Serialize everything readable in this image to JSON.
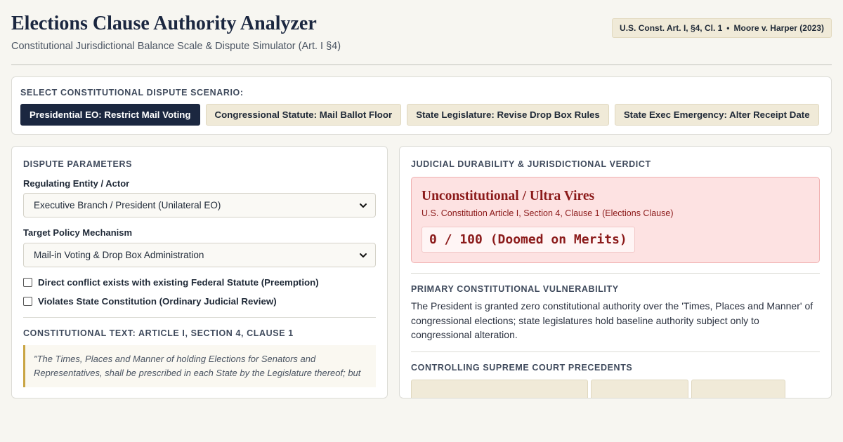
{
  "header": {
    "title": "Elections Clause Authority Analyzer",
    "subtitle": "Constitutional Jurisdictional Balance Scale & Dispute Simulator (Art. I §4)",
    "citation_primary": "U.S. Const. Art. I, §4, Cl. 1",
    "citation_separator": "•",
    "citation_secondary": "Moore v. Harper (2023)"
  },
  "scenarios": {
    "label": "SELECT CONSTITUTIONAL DISPUTE SCENARIO:",
    "options": [
      {
        "label": "Presidential EO: Restrict Mail Voting",
        "active": true
      },
      {
        "label": "Congressional Statute: Mail Ballot Floor",
        "active": false
      },
      {
        "label": "State Legislature: Revise Drop Box Rules",
        "active": false
      },
      {
        "label": "State Exec Emergency: Alter Receipt Date",
        "active": false
      }
    ]
  },
  "parameters": {
    "heading": "DISPUTE PARAMETERS",
    "actor_label": "Regulating Entity / Actor",
    "actor_value": "Executive Branch / President (Unilateral EO)",
    "mechanism_label": "Target Policy Mechanism",
    "mechanism_value": "Mail-in Voting & Drop Box Administration",
    "checkbox_preemption": "Direct conflict exists with existing Federal Statute (Preemption)",
    "checkbox_state_constitution": "Violates State Constitution (Ordinary Judicial Review)"
  },
  "constitutional_text": {
    "heading": "CONSTITUTIONAL TEXT: ARTICLE I, SECTION 4, CLAUSE 1",
    "quote": "\"The Times, Places and Manner of holding Elections for Senators and Representatives, shall be prescribed in each State by the Legislature thereof; but"
  },
  "verdict": {
    "heading": "JUDICIAL DURABILITY & JURISDICTIONAL VERDICT",
    "title": "Unconstitutional / Ultra Vires",
    "source": "U.S. Constitution Article I, Section 4, Clause 1 (Elections Clause)",
    "score": "0 / 100 (Doomed on Merits)"
  },
  "vulnerability": {
    "heading": "PRIMARY CONSTITUTIONAL VULNERABILITY",
    "text": "The President is granted zero constitutional authority over the 'Times, Places and Manner' of congressional elections; state legislatures hold baseline authority subject only to congressional alteration."
  },
  "precedents": {
    "heading": "CONTROLLING SUPREME COURT PRECEDENTS"
  },
  "colors": {
    "navy": "#1b2740",
    "verdict_red": "#8b1a1a",
    "verdict_bg": "#fde2e2",
    "accent_gold": "#c9a544",
    "chip_bg": "#f0ead8",
    "page_bg": "#f7f6f1"
  }
}
